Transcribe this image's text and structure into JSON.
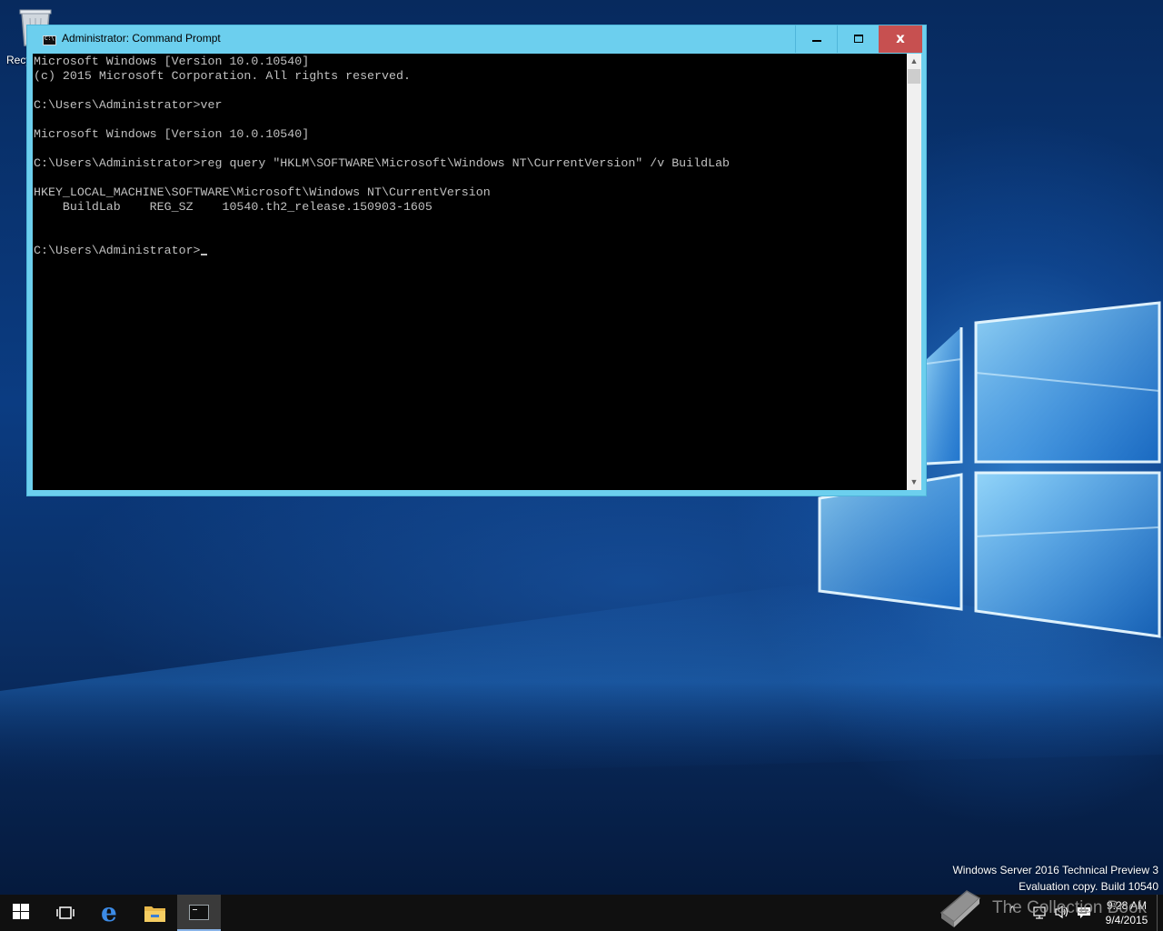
{
  "desktop": {
    "recycle_bin_label": "Recycle Bin"
  },
  "window": {
    "title": "Administrator: Command Prompt",
    "close_glyph": "x",
    "console_lines": [
      "Microsoft Windows [Version 10.0.10540]",
      "(c) 2015 Microsoft Corporation. All rights reserved.",
      "",
      "C:\\Users\\Administrator>ver",
      "",
      "Microsoft Windows [Version 10.0.10540]",
      "",
      "C:\\Users\\Administrator>reg query \"HKLM\\SOFTWARE\\Microsoft\\Windows NT\\CurrentVersion\" /v BuildLab",
      "",
      "HKEY_LOCAL_MACHINE\\SOFTWARE\\Microsoft\\Windows NT\\CurrentVersion",
      "    BuildLab    REG_SZ    10540.th2_release.150903-1605",
      "",
      ""
    ],
    "prompt": "C:\\Users\\Administrator>",
    "scroll_up_glyph": "▲",
    "scroll_down_glyph": "▼"
  },
  "watermark": {
    "line1": "Windows Server 2016 Technical Preview 3",
    "line2": "Evaluation copy. Build 10540"
  },
  "taskbar": {
    "clock_time": "9:28 AM",
    "clock_date": "9/4/2015",
    "tray_chevron": "^",
    "edge_glyph": "e",
    "items": [
      "start",
      "task-view",
      "edge",
      "file-explorer",
      "command-prompt"
    ]
  },
  "overlay": {
    "text": "The Collection Book"
  },
  "colors": {
    "titlebar": "#6ccfee",
    "close_button": "#c75050",
    "console_bg": "#000000",
    "console_text": "#c0c0c0",
    "taskbar": "#101010"
  }
}
